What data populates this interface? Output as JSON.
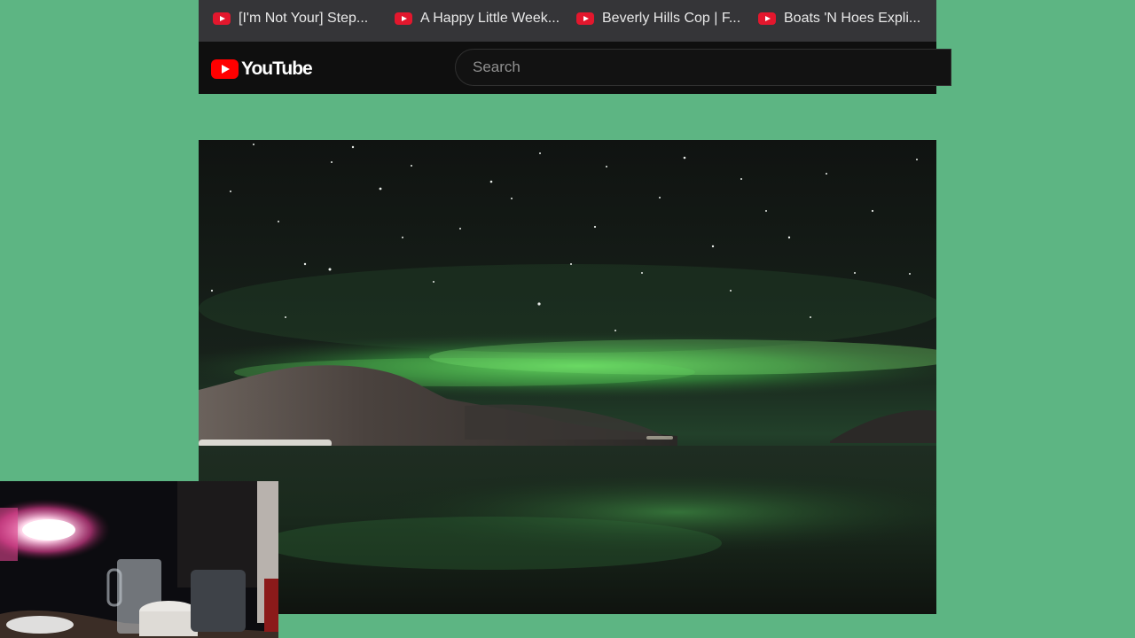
{
  "bookmarks": [
    {
      "label": "[I'm Not Your] Step...",
      "icon": "youtube-icon"
    },
    {
      "label": "A Happy Little Week...",
      "icon": "youtube-icon"
    },
    {
      "label": "Beverly Hills Cop | F...",
      "icon": "youtube-icon"
    },
    {
      "label": "Boats 'N Hoes Expli...",
      "icon": "youtube-icon"
    }
  ],
  "header": {
    "logo_text": "YouTube",
    "search_placeholder": "Search"
  },
  "colors": {
    "page_background": "#5db583",
    "bookmarks_bar": "#353538",
    "header_background": "#0f0f0f",
    "brand_red": "#ff0000",
    "aurora_green": "#5cd35a"
  }
}
